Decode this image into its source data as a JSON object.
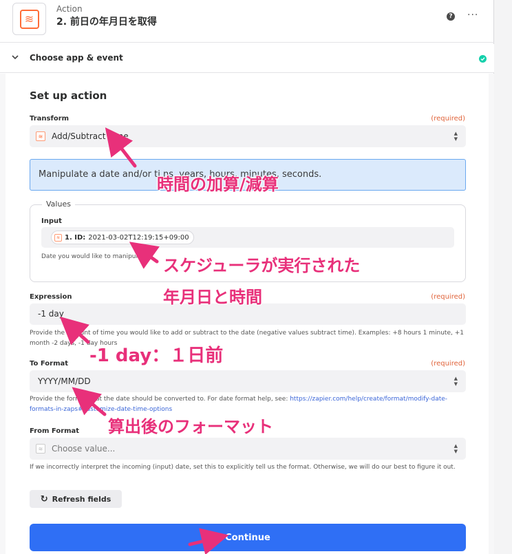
{
  "header": {
    "step_label": "Action",
    "step_title": "2. 前日の年月日を取得",
    "help_symbol": "?",
    "more_symbol": "···"
  },
  "section": {
    "title": "Choose app & event"
  },
  "setup": {
    "title": "Set up action",
    "transform": {
      "label": "Transform",
      "required": "(required)",
      "value": "Add/Subtract Time"
    },
    "info_text": "Manipulate a date and/or ti                                   ns, years, hours, minutes, seconds.",
    "values": {
      "legend": "Values",
      "input_label": "Input",
      "pill_step": "1. ID:",
      "pill_value": "2021-03-02T12:19:15+09:00",
      "help": "Date you would like to manipul"
    },
    "expression": {
      "label": "Expression",
      "required": "(required)",
      "value": "-1 day",
      "help_line1": "Provide the amount of time you would like to add or subtract to the date (negative values subtract time). Examples: +8 hours 1 minute, +1",
      "help_line2": "month -2 days, -1 day       hours"
    },
    "to_format": {
      "label": "To Format",
      "required": "(required)",
      "value": "YYYY/MM/DD",
      "help_prefix": "Provide the format that the date should be converted to. For date format help, see: ",
      "help_link1": "https://zapier.com/help/create/format/modify-date-",
      "help_link2": "formats-in-zaps#customize-date-time-options"
    },
    "from_format": {
      "label": "From Format",
      "placeholder": "Choose value...",
      "help": "If we incorrectly interpret the incoming (input) date, set this to explicitly tell us the format. Otherwise, we will do our best to figure it out."
    },
    "refresh_label": "Refresh fields",
    "continue_label": "Continue"
  },
  "annotations": {
    "a1": "時間の加算/減算",
    "a2": "スケジューラが実行された",
    "a3": "年月日と時間",
    "a4": "-1 day：１日前",
    "a5": "算出後のフォーマット"
  },
  "colors": {
    "accent_orange": "#ff6c37",
    "primary_blue": "#2f6ff5",
    "success_green": "#13d0ab",
    "annotation_pink": "#e8307a"
  }
}
